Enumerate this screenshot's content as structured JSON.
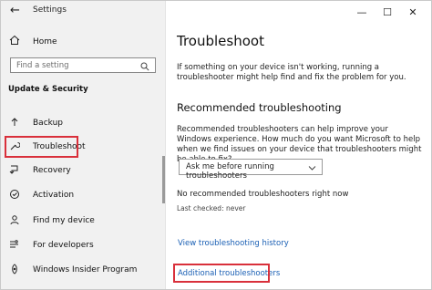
{
  "window": {
    "title": "Settings"
  },
  "controls": {
    "minimize": "—",
    "maximize": "☐",
    "close": "✕"
  },
  "sidebar": {
    "home_label": "Home",
    "search_placeholder": "Find a setting",
    "section_title": "Update & Security",
    "items": [
      {
        "label": "Backup"
      },
      {
        "label": "Troubleshoot"
      },
      {
        "label": "Recovery"
      },
      {
        "label": "Activation"
      },
      {
        "label": "Find my device"
      },
      {
        "label": "For developers"
      },
      {
        "label": "Windows Insider Program"
      }
    ]
  },
  "main": {
    "title": "Troubleshoot",
    "intro": "If something on your device isn't working, running a troubleshooter might help find and fix the problem for you.",
    "recommended_title": "Recommended troubleshooting",
    "recommended_desc": "Recommended troubleshooters can help improve your Windows experience. How much do you want Microsoft to help when we find issues on your device that troubleshooters might be able to fix?",
    "dropdown_value": "Ask me before running troubleshooters",
    "none_text": "No recommended troubleshooters right now",
    "last_checked": "Last checked: never",
    "view_history_link": "View troubleshooting history",
    "additional_link": "Additional troubleshooters"
  },
  "colors": {
    "highlight": "#d9303b",
    "link": "#1a5fb4",
    "sidebar_bg": "#f1f1f1"
  }
}
